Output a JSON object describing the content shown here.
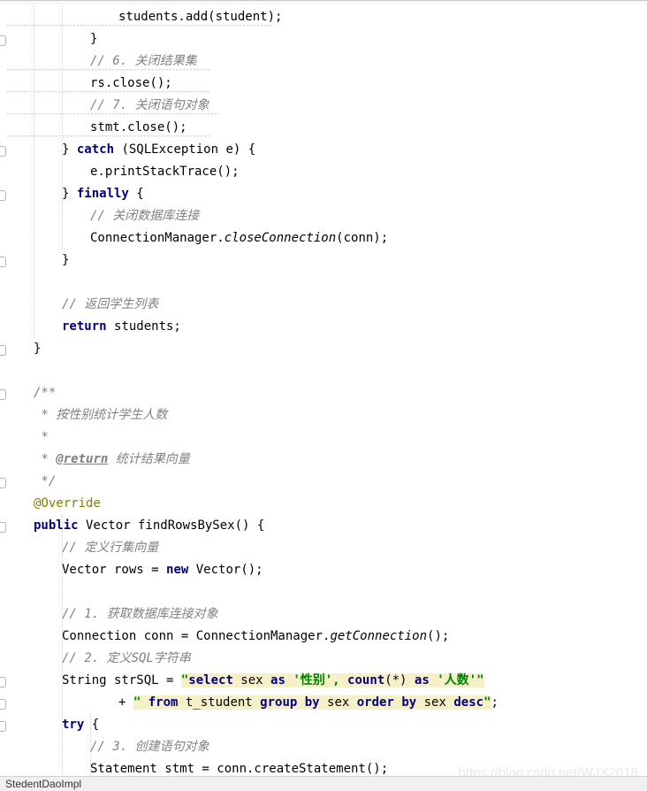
{
  "editor": {
    "lines": [
      {
        "indent": 4,
        "tokens": [
          {
            "t": "students.add(student);",
            "c": ""
          }
        ]
      },
      {
        "indent": 3,
        "tokens": [
          {
            "t": "}",
            "c": ""
          }
        ]
      },
      {
        "indent": 3,
        "tokens": [
          {
            "t": "// 6. 关闭结果集",
            "c": "cm"
          }
        ]
      },
      {
        "indent": 3,
        "tokens": [
          {
            "t": "rs.close();",
            "c": ""
          }
        ]
      },
      {
        "indent": 3,
        "tokens": [
          {
            "t": "// 7. 关闭语句对象",
            "c": "cm"
          }
        ]
      },
      {
        "indent": 3,
        "tokens": [
          {
            "t": "stmt.close();",
            "c": ""
          }
        ]
      },
      {
        "indent": 2,
        "tokens": [
          {
            "t": "} ",
            "c": ""
          },
          {
            "t": "catch",
            "c": "kw"
          },
          {
            "t": " (SQLException e) {",
            "c": ""
          }
        ]
      },
      {
        "indent": 3,
        "tokens": [
          {
            "t": "e.printStackTrace();",
            "c": ""
          }
        ]
      },
      {
        "indent": 2,
        "tokens": [
          {
            "t": "} ",
            "c": ""
          },
          {
            "t": "finally",
            "c": "kw"
          },
          {
            "t": " {",
            "c": ""
          }
        ]
      },
      {
        "indent": 3,
        "tokens": [
          {
            "t": "// 关闭数据库连接",
            "c": "cm"
          }
        ]
      },
      {
        "indent": 3,
        "tokens": [
          {
            "t": "ConnectionManager.",
            "c": ""
          },
          {
            "t": "closeConnection",
            "c": "it"
          },
          {
            "t": "(conn);",
            "c": ""
          }
        ]
      },
      {
        "indent": 2,
        "tokens": [
          {
            "t": "}",
            "c": ""
          }
        ]
      },
      {
        "indent": 0,
        "tokens": []
      },
      {
        "indent": 2,
        "tokens": [
          {
            "t": "// 返回学生列表",
            "c": "cm"
          }
        ]
      },
      {
        "indent": 2,
        "tokens": [
          {
            "t": "return",
            "c": "kw"
          },
          {
            "t": " students;",
            "c": ""
          }
        ]
      },
      {
        "indent": 1,
        "tokens": [
          {
            "t": "}",
            "c": ""
          }
        ]
      },
      {
        "indent": 0,
        "tokens": []
      },
      {
        "indent": 1,
        "tokens": [
          {
            "t": "/**",
            "c": "jd"
          }
        ]
      },
      {
        "indent": 1,
        "tokens": [
          {
            "t": " * 按性别统计学生人数",
            "c": "jd"
          }
        ]
      },
      {
        "indent": 1,
        "tokens": [
          {
            "t": " *",
            "c": "jd"
          }
        ]
      },
      {
        "indent": 1,
        "tokens": [
          {
            "t": " * ",
            "c": "jd"
          },
          {
            "t": "@return",
            "c": "tag"
          },
          {
            "t": " 统计结果向量",
            "c": "jd"
          }
        ]
      },
      {
        "indent": 1,
        "tokens": [
          {
            "t": " */",
            "c": "jd"
          }
        ]
      },
      {
        "indent": 1,
        "tokens": [
          {
            "t": "@Override",
            "c": "ann"
          }
        ]
      },
      {
        "indent": 1,
        "tokens": [
          {
            "t": "public",
            "c": "kw"
          },
          {
            "t": " Vector findRowsBySex() {",
            "c": ""
          }
        ]
      },
      {
        "indent": 2,
        "tokens": [
          {
            "t": "// 定义行集向量",
            "c": "cm"
          }
        ]
      },
      {
        "indent": 2,
        "tokens": [
          {
            "t": "Vector rows = ",
            "c": ""
          },
          {
            "t": "new",
            "c": "kw"
          },
          {
            "t": " Vector();",
            "c": ""
          }
        ]
      },
      {
        "indent": 0,
        "tokens": []
      },
      {
        "indent": 2,
        "tokens": [
          {
            "t": "// 1. 获取数据库连接对象",
            "c": "cm"
          }
        ]
      },
      {
        "indent": 2,
        "tokens": [
          {
            "t": "Connection conn = ConnectionManager.",
            "c": ""
          },
          {
            "t": "getConnection",
            "c": "it"
          },
          {
            "t": "();",
            "c": ""
          }
        ]
      },
      {
        "indent": 2,
        "tokens": [
          {
            "t": "// 2. 定义SQL字符串",
            "c": "cm"
          }
        ]
      },
      {
        "indent": 2,
        "tokens": [
          {
            "t": "String strSQL = ",
            "c": ""
          },
          {
            "t": "\"",
            "c": "str hl"
          },
          {
            "t": "select",
            "c": "sqlkw hl"
          },
          {
            "t": " sex ",
            "c": "sqlid hl"
          },
          {
            "t": "as",
            "c": "sqlkw hl"
          },
          {
            "t": " '性别', ",
            "c": "str hl"
          },
          {
            "t": "count",
            "c": "sqlkw hl"
          },
          {
            "t": "(*) ",
            "c": "sqlid hl"
          },
          {
            "t": "as",
            "c": "sqlkw hl"
          },
          {
            "t": " '人数'",
            "c": "str hl"
          },
          {
            "t": "\"",
            "c": "str hl"
          }
        ]
      },
      {
        "indent": 4,
        "tokens": [
          {
            "t": "+ ",
            "c": ""
          },
          {
            "t": "\" ",
            "c": "str hl"
          },
          {
            "t": "from",
            "c": "sqlkw hl"
          },
          {
            "t": " t_student ",
            "c": "sqlid hl"
          },
          {
            "t": "group by",
            "c": "sqlkw hl"
          },
          {
            "t": " sex ",
            "c": "sqlid hl"
          },
          {
            "t": "order by",
            "c": "sqlkw hl"
          },
          {
            "t": " sex ",
            "c": "sqlid hl"
          },
          {
            "t": "desc",
            "c": "sqlkw hl"
          },
          {
            "t": "\"",
            "c": "str hl"
          },
          {
            "t": ";",
            "c": ""
          }
        ]
      },
      {
        "indent": 2,
        "tokens": [
          {
            "t": "try",
            "c": "kw"
          },
          {
            "t": " {",
            "c": ""
          }
        ]
      },
      {
        "indent": 3,
        "tokens": [
          {
            "t": "// 3. 创建语句对象",
            "c": "cm"
          }
        ]
      },
      {
        "indent": 3,
        "tokens": [
          {
            "t": "Statement stmt = conn.createStatement();",
            "c": ""
          }
        ]
      }
    ]
  },
  "status": {
    "file_name": "StedentDaoImpl"
  },
  "watermark": "https://blog.csdn.net/WJX2018"
}
